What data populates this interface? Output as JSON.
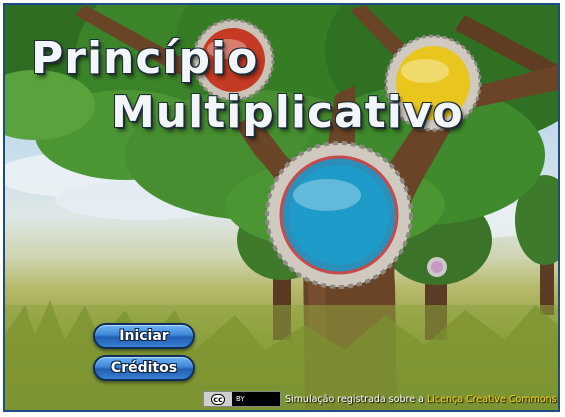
{
  "title": {
    "line1": "Princípio",
    "line2": "Multiplicativo"
  },
  "buttons": {
    "start_label": "Iniciar",
    "credits_label": "Créditos"
  },
  "license": {
    "badge_left": "cc",
    "badge_right": "BY",
    "text": "Simulação registrada sobre a",
    "link_text": "Licença Creative Commons"
  },
  "colors": {
    "frame_border": "#1d4c86",
    "button_blue": "#3e87d8",
    "link_yellow": "#ffd21a",
    "orb_red": "#c43a22",
    "orb_yellow": "#e8c61e",
    "orb_blue": "#1f8fc2"
  }
}
